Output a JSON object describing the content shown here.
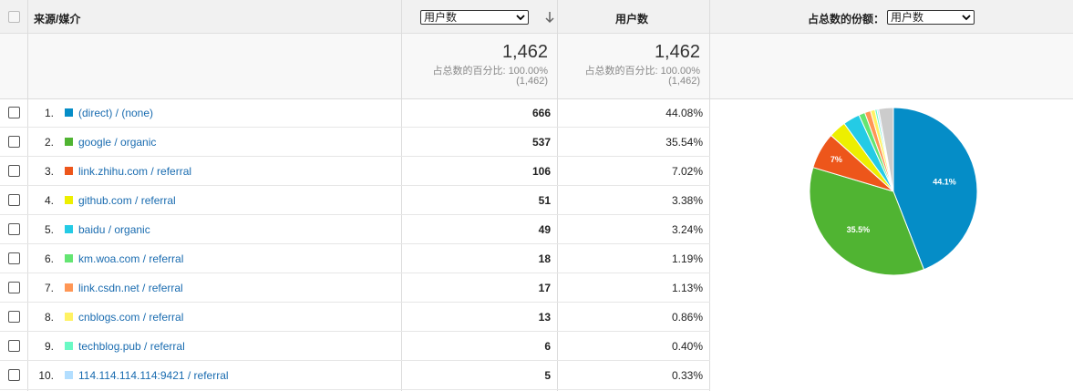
{
  "header": {
    "source_medium": "来源/媒介",
    "metric_select": "用户数",
    "users_col": "用户数",
    "share_label": "占总数的份额：",
    "share_select": "用户数"
  },
  "summary": {
    "col1": {
      "total": "1,462",
      "pct_line": "占总数的百分比: 100.00%",
      "paren": "(1,462)"
    },
    "col2": {
      "total": "1,462",
      "pct_line": "占总数的百分比: 100.00%",
      "paren": "(1,462)"
    }
  },
  "rows": [
    {
      "num": "1.",
      "source": "(direct) / (none)",
      "users": "666",
      "pct": "44.08%",
      "color": "#058dc7"
    },
    {
      "num": "2.",
      "source": "google / organic",
      "users": "537",
      "pct": "35.54%",
      "color": "#50b432"
    },
    {
      "num": "3.",
      "source": "link.zhihu.com / referral",
      "users": "106",
      "pct": "7.02%",
      "color": "#ed561b"
    },
    {
      "num": "4.",
      "source": "github.com / referral",
      "users": "51",
      "pct": "3.38%",
      "color": "#edef00"
    },
    {
      "num": "5.",
      "source": "baidu / organic",
      "users": "49",
      "pct": "3.24%",
      "color": "#24cbe5"
    },
    {
      "num": "6.",
      "source": "km.woa.com / referral",
      "users": "18",
      "pct": "1.19%",
      "color": "#64e572"
    },
    {
      "num": "7.",
      "source": "link.csdn.net / referral",
      "users": "17",
      "pct": "1.13%",
      "color": "#ff9655"
    },
    {
      "num": "8.",
      "source": "cnblogs.com / referral",
      "users": "13",
      "pct": "0.86%",
      "color": "#fff263"
    },
    {
      "num": "9.",
      "source": "techblog.pub / referral",
      "users": "6",
      "pct": "0.40%",
      "color": "#6af9c4"
    },
    {
      "num": "10.",
      "source": "114.114.114.114:9421 / referral",
      "users": "5",
      "pct": "0.33%",
      "color": "#b2deff"
    }
  ],
  "chart_data": {
    "type": "pie",
    "values": [
      44.08,
      35.54,
      7.02,
      3.38,
      3.24,
      1.19,
      1.13,
      0.86,
      0.4,
      0.33,
      2.83
    ],
    "colors": [
      "#058dc7",
      "#50b432",
      "#ed561b",
      "#edef00",
      "#24cbe5",
      "#64e572",
      "#ff9655",
      "#fff263",
      "#6af9c4",
      "#b2deff",
      "#cccccc"
    ],
    "slice_labels": [
      "44.1%",
      "35.5%",
      "7%",
      "",
      "",
      "",
      "",
      "",
      "",
      "",
      ""
    ]
  }
}
